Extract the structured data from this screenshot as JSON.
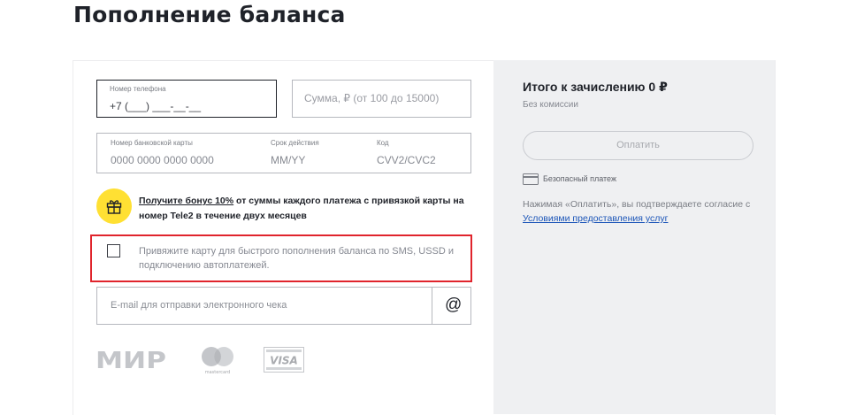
{
  "page": {
    "title": "Пополнение баланса"
  },
  "form": {
    "phone": {
      "label": "Номер телефона",
      "value": "+7 (___) ___-__-__"
    },
    "amount": {
      "placeholder": "Сумма, ₽ (от 100 до 15000)"
    },
    "card": {
      "number_label": "Номер банковской карты",
      "number_placeholder": "0000 0000 0000 0000",
      "expiry_label": "Срок действия",
      "expiry_placeholder": "MM/YY",
      "code_label": "Код",
      "code_placeholder": "CVV2/CVC2"
    },
    "bonus": {
      "link_text": "Получите бонус 10%",
      "text": " от суммы каждого платежа с привязкой карты на номер Tele2 в течение двух месяцев"
    },
    "bind_card": {
      "checked": false,
      "text": "Привяжите карту для быстрого пополнения баланса по SMS, USSD и подключению автоплатежей."
    },
    "email": {
      "placeholder": "E-mail для отправки электронного чека",
      "icon": "@"
    },
    "payment_logos": {
      "mir": "МИР",
      "mastercard": "mastercard",
      "visa": "VISA"
    }
  },
  "summary": {
    "total": "Итого к зачислению 0 ₽",
    "fee": "Без комиссии",
    "pay_button": "Оплатить",
    "secure": "Безопасный платеж",
    "agreement_prefix": "Нажимая «Оплатить», вы подтверждаете согласие с ",
    "agreement_link": "Условиями предоставления услуг"
  },
  "colors": {
    "accent_yellow": "#ffe033",
    "highlight_red": "#e0242c",
    "link_blue": "#1b55b8",
    "panel_bg": "#eff0f2"
  }
}
